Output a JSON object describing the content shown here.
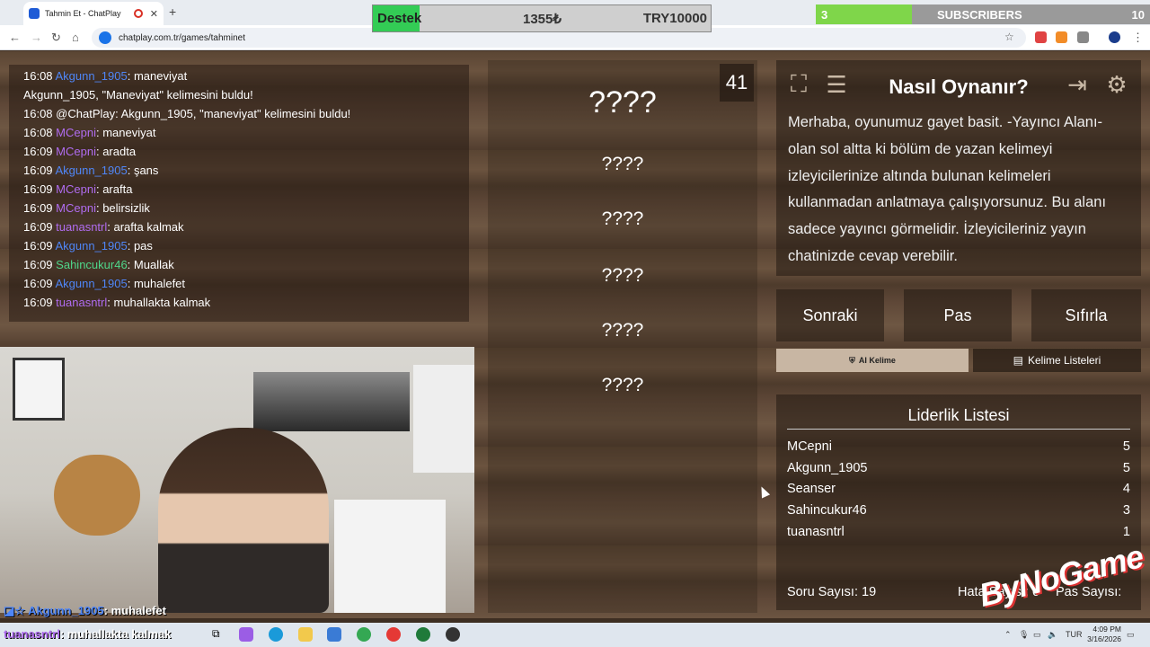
{
  "browser": {
    "tab_title": "Tahmin Et - ChatPlay",
    "url": "chatplay.com.tr/games/tahminet"
  },
  "donation": {
    "label": "Destek",
    "current": "1355₺",
    "goal": "TRY10000",
    "progress_fraction": 0.1355,
    "fill_color": "#33cc55"
  },
  "subscribers": {
    "count": "3",
    "label": "SUBSCRIBERS",
    "goal": "10",
    "fill_color": "#7fd64a"
  },
  "chat": {
    "messages": [
      {
        "time": "16:08",
        "user": "Akgunn_1905",
        "sep": ": ",
        "text": "maneviyat"
      },
      {
        "time": "",
        "user": "",
        "sep": "",
        "text": ""
      },
      {
        "time": "16:08",
        "user": "@ChatPlay",
        "sep": ": ",
        "text": "Akgunn_1905, \"maneviyat\" kelimesini buldu!"
      },
      {
        "time": "16:08",
        "user": "MCepni",
        "sep": ": ",
        "text": "maneviyat"
      },
      {
        "time": "16:09",
        "user": "MCepni",
        "sep": ": ",
        "text": "aradta"
      },
      {
        "time": "16:09",
        "user": "Akgunn_1905",
        "sep": ": ",
        "text": "şans"
      },
      {
        "time": "16:09",
        "user": "MCepni",
        "sep": ": ",
        "text": "arafta"
      },
      {
        "time": "16:09",
        "user": "MCepni",
        "sep": ": ",
        "text": "belirsizlik"
      },
      {
        "time": "16:09",
        "user": "tuanasntrl",
        "sep": ": ",
        "text": "arafta kalmak"
      },
      {
        "time": "16:09",
        "user": "Akgunn_1905",
        "sep": ": ",
        "text": "pas"
      },
      {
        "time": "16:09",
        "user": "Sahincukur46",
        "sep": ": ",
        "text": "Muallak"
      },
      {
        "time": "16:09",
        "user": "Akgunn_1905",
        "sep": ": ",
        "text": "muhalefet"
      },
      {
        "time": "16:09",
        "user": "tuanasntrl",
        "sep": ": ",
        "text": "muhallakta kalmak"
      }
    ],
    "found_notice": {
      "user": "Akgunn_1905",
      "word": "\"Maneviyat\"",
      "suffix": " kelimesini buldu!",
      "user_sep": ", "
    }
  },
  "game": {
    "timer": "41",
    "main_word": "????",
    "forbidden_words": [
      "????",
      "????",
      "????",
      "????",
      "????"
    ]
  },
  "help": {
    "title": "Nasıl Oynanır?",
    "text": "Merhaba, oyunumuz gayet basit. -Yayıncı Alanı- olan sol altta ki bölüm de yazan kelimeyi izleyicilerinize altında bulunan kelimeleri kullanmadan anlatmaya çalışıyorsunuz. Bu alanı sadece yayıncı görmelidir. İzleyicileriniz yayın chatinizde cevap verebilir.",
    "icons": [
      "fullscreen-icon",
      "list-icon",
      "logout-icon",
      "gear-icon"
    ]
  },
  "actions": {
    "next": "Sonraki",
    "pass": "Pas",
    "reset": "Sıfırla",
    "ai_word": "AI Kelime",
    "word_lists": "Kelime Listeleri"
  },
  "leaderboard": {
    "title": "Liderlik Listesi",
    "rows": [
      {
        "name": "MCepni",
        "score": "5"
      },
      {
        "name": "Akgunn_1905",
        "score": "5"
      },
      {
        "name": "Seanser",
        "score": "4"
      },
      {
        "name": "Sahincukur46",
        "score": "3"
      },
      {
        "name": "tuanasntrl",
        "score": "1"
      }
    ],
    "question_count": "Soru Sayısı: 19",
    "error_count": "Hata Sayısı: 0",
    "pass_count": "Pas Sayısı:"
  },
  "watermark": "ByNoGame",
  "overlay_chat": [
    {
      "user": "Akgunn_1905",
      "text": ": muhalefet"
    },
    {
      "user": "tuanasntrl",
      "text": ": muhallakta kalmak"
    }
  ],
  "taskbar": {
    "lang": "TUR",
    "time": "4:09 PM",
    "date": "3/16/2026"
  }
}
